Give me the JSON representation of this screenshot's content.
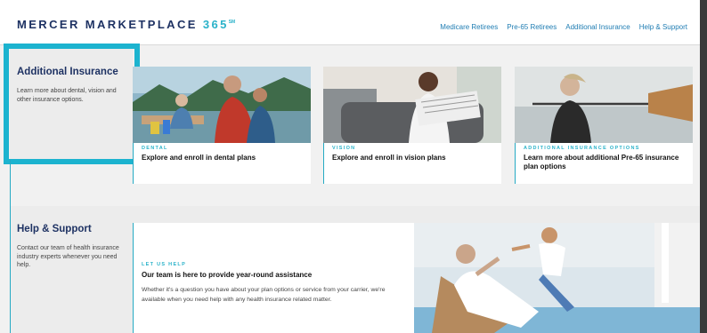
{
  "header": {
    "brand_name": "MERCER MARKETPLACE",
    "brand_number": "365",
    "brand_mark": "SM",
    "nav": [
      "Medicare Retirees",
      "Pre-65 Retirees",
      "Additional Insurance",
      "Help & Support"
    ]
  },
  "additional_insurance": {
    "title": "Additional Insurance",
    "description": "Learn more about dental, vision and other insurance options.",
    "cards": [
      {
        "kicker": "DENTAL",
        "title": "Explore and enroll in dental plans",
        "image": "family-picnic-photo"
      },
      {
        "kicker": "VISION",
        "title": "Explore and enroll in vision plans",
        "image": "man-reading-newspaper-photo"
      },
      {
        "kicker": "ADDITIONAL INSURANCE OPTIONS",
        "title": "Learn more about additional Pre-65 insurance plan options",
        "image": "woman-paddling-photo"
      }
    ]
  },
  "help_support": {
    "title": "Help & Support",
    "description": "Contact our team of health insurance industry experts whenever you need help.",
    "kicker": "LET US HELP",
    "headline": "Our team is here to provide year-round assistance",
    "body": "Whether it's a question you have about your plan options or service from your carrier, we're available when you need help with any health insurance related matter.",
    "image": "grandfather-high-five-photo"
  },
  "colors": {
    "navy": "#1e3263",
    "accent": "#2ab2c9",
    "link": "#1f7db3",
    "highlight": "#1cb3cf"
  }
}
